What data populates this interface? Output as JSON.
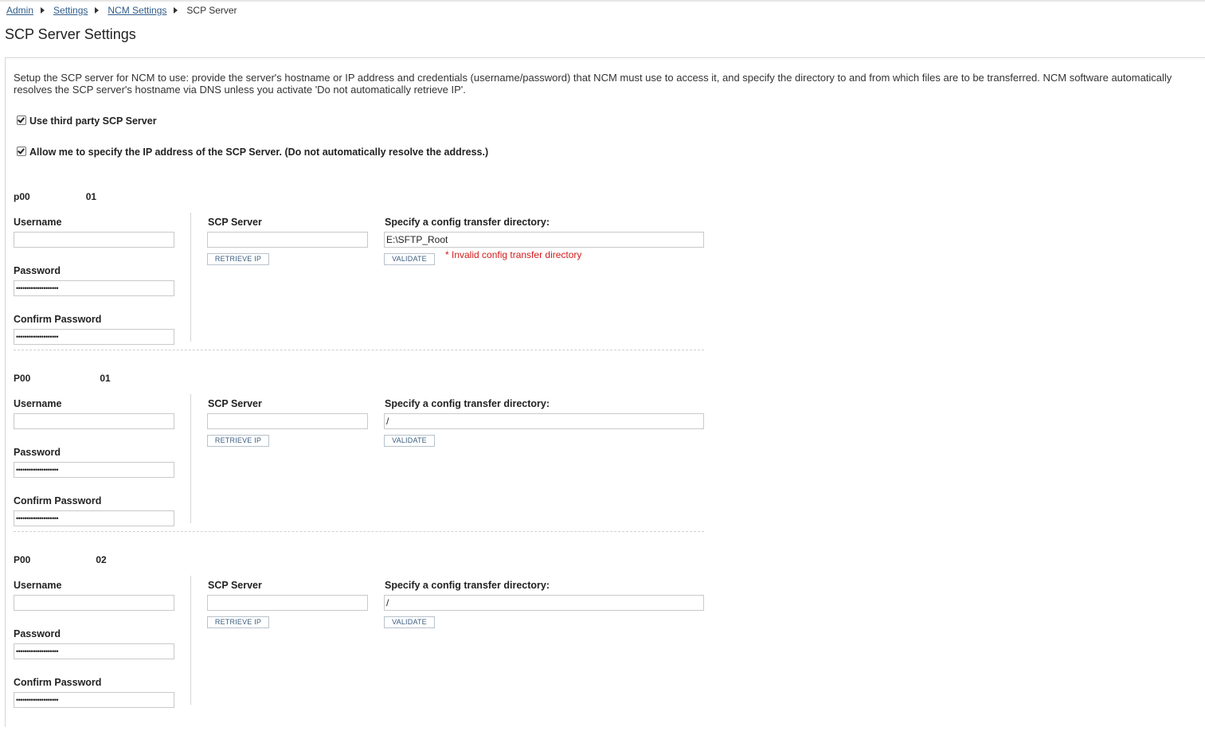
{
  "breadcrumb": {
    "items": [
      "Admin",
      "Settings",
      "NCM Settings"
    ],
    "current": "SCP Server"
  },
  "page_title": "SCP Server Settings",
  "description": "Setup the SCP server for NCM to use: provide the server's hostname or IP address and credentials (username/password) that NCM must use to access it, and specify the directory to and from which files are to be transferred. NCM software automatically resolves the SCP server's hostname via DNS unless you activate 'Do not automatically retrieve IP'.",
  "options": {
    "third_party": {
      "label": "Use third party SCP Server",
      "checked": true
    },
    "specify_ip": {
      "label": "Allow me to specify the IP address of the SCP Server. (Do not automatically resolve the address.)",
      "checked": true
    }
  },
  "labels": {
    "username": "Username",
    "password": "Password",
    "confirm_password": "Confirm Password",
    "scp_server": "SCP Server",
    "directory": "Specify a config transfer directory:",
    "retrieve_ip": "RETRIEVE IP",
    "validate": "VALIDATE"
  },
  "servers": [
    {
      "name_prefix": "p00",
      "name_suffix": "01",
      "username": "",
      "password": "••••••••••••••••••••",
      "confirm_password": "••••••••••••••••••••",
      "scp_server": "",
      "directory": "E:\\SFTP_Root",
      "error": "* Invalid config transfer directory"
    },
    {
      "name_prefix": "P00",
      "name_suffix": "01",
      "username": "",
      "password": "••••••••••••••••••••",
      "confirm_password": "••••••••••••••••••••",
      "scp_server": "",
      "directory": "/",
      "error": ""
    },
    {
      "name_prefix": "P00",
      "name_suffix": "02",
      "username": "",
      "password": "••••••••••••••••••••",
      "confirm_password": "••••••••••••••••••••",
      "scp_server": "",
      "directory": "/",
      "error": ""
    }
  ]
}
